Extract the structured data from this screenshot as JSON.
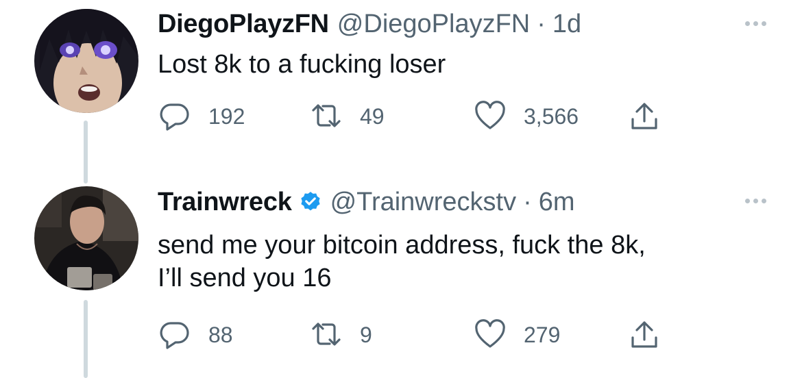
{
  "tweets": [
    {
      "display_name": "DiegoPlayzFN",
      "handle": "@DiegoPlayzFN",
      "dot": "·",
      "time": "1d",
      "verified": false,
      "text_lines": [
        "Lost 8k to a fucking loser"
      ],
      "actions": {
        "replies": "192",
        "retweets": "49",
        "likes": "3,566"
      }
    },
    {
      "display_name": "Trainwreck",
      "handle": "@Trainwreckstv",
      "dot": "·",
      "time": "6m",
      "verified": true,
      "text_lines": [
        "send me your bitcoin address, fuck the 8k,",
        "I’ll send you 16"
      ],
      "actions": {
        "replies": "88",
        "retweets": "9",
        "likes": "279"
      }
    }
  ],
  "colors": {
    "text_primary": "#0f1419",
    "text_secondary": "#536471",
    "thread_line": "#cfd9de",
    "verified_blue": "#1d9bf0"
  },
  "icons": {
    "reply": "reply-icon",
    "retweet": "retweet-icon",
    "like": "heart-icon",
    "share": "share-icon",
    "more": "more-icon",
    "verified": "verified-badge-icon"
  }
}
